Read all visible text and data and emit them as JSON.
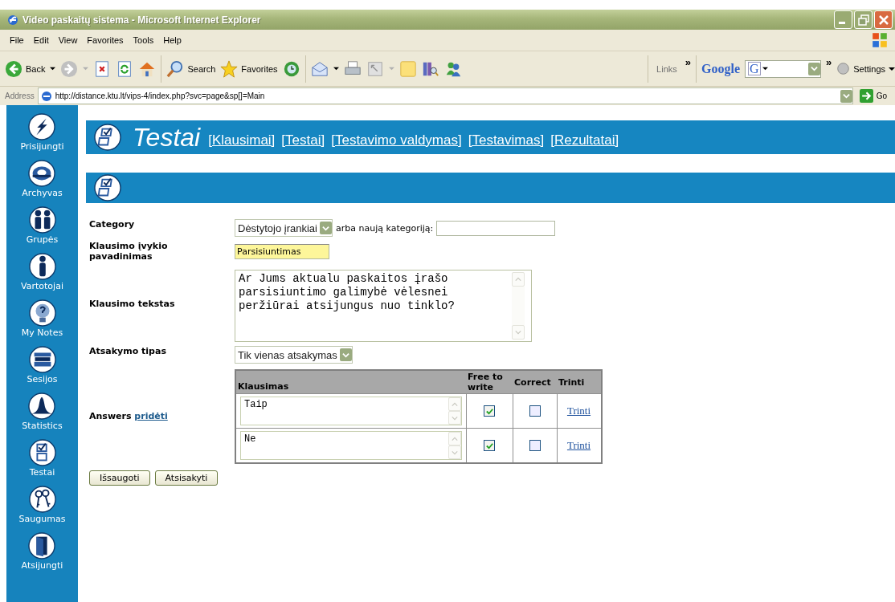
{
  "window": {
    "title": "Video paskaitų sistema - Microsoft Internet Explorer"
  },
  "menu": [
    "File",
    "Edit",
    "View",
    "Favorites",
    "Tools",
    "Help"
  ],
  "toolbar": {
    "back": "Back",
    "search": "Search",
    "favorites": "Favorites",
    "links": "Links",
    "links_more": "»",
    "google": "Google",
    "google_field": "G",
    "more": "»",
    "settings": "Settings"
  },
  "address": {
    "label": "Address",
    "url": "http://distance.ktu.lt/vips-4/index.php?svc=page&sp[]=Main",
    "go": "Go"
  },
  "sidebar": {
    "items": [
      {
        "label": "Prisijungti"
      },
      {
        "label": "Archyvas"
      },
      {
        "label": "Grupės"
      },
      {
        "label": "Vartotojai"
      },
      {
        "label": "My Notes"
      },
      {
        "label": "Sesijos"
      },
      {
        "label": "Statistics"
      },
      {
        "label": "Testai"
      },
      {
        "label": "Saugumas"
      },
      {
        "label": "Atsijungti"
      }
    ]
  },
  "header": {
    "title": "Testai",
    "links": [
      "[Klausimai]",
      "[Testai]",
      "[Testavimo valdymas]",
      "[Testavimas]",
      "[Rezultatai]"
    ]
  },
  "form": {
    "category": {
      "label": "Category",
      "value": "Dėstytojo įrankiai",
      "or_label": "arba naują kategoriją:"
    },
    "name": {
      "label": "Klausimo įvykio pavadinimas",
      "value": "Parsisiuntimas"
    },
    "text": {
      "label": "Klausimo tekstas",
      "value": "Ar Jums aktualu paskaitos įrašo parsisiuntimo galimybė vėlesnei peržiūrai atsijungus nuo tinklo?"
    },
    "answer_type": {
      "label": "Atsakymo tipas",
      "value": "Tik vienas atsakymas"
    },
    "answers": {
      "label": "Answers",
      "add_link": "pridėti",
      "columns": [
        "Klausimas",
        "Free to write",
        "Correct",
        "Trinti"
      ],
      "rows": [
        {
          "text": "Taip",
          "free_to_write": true,
          "correct": false,
          "delete": "Trinti"
        },
        {
          "text": "Ne",
          "free_to_write": true,
          "correct": false,
          "delete": "Trinti"
        }
      ]
    },
    "buttons": [
      "Išsaugoti",
      "Atsisakyti"
    ]
  }
}
